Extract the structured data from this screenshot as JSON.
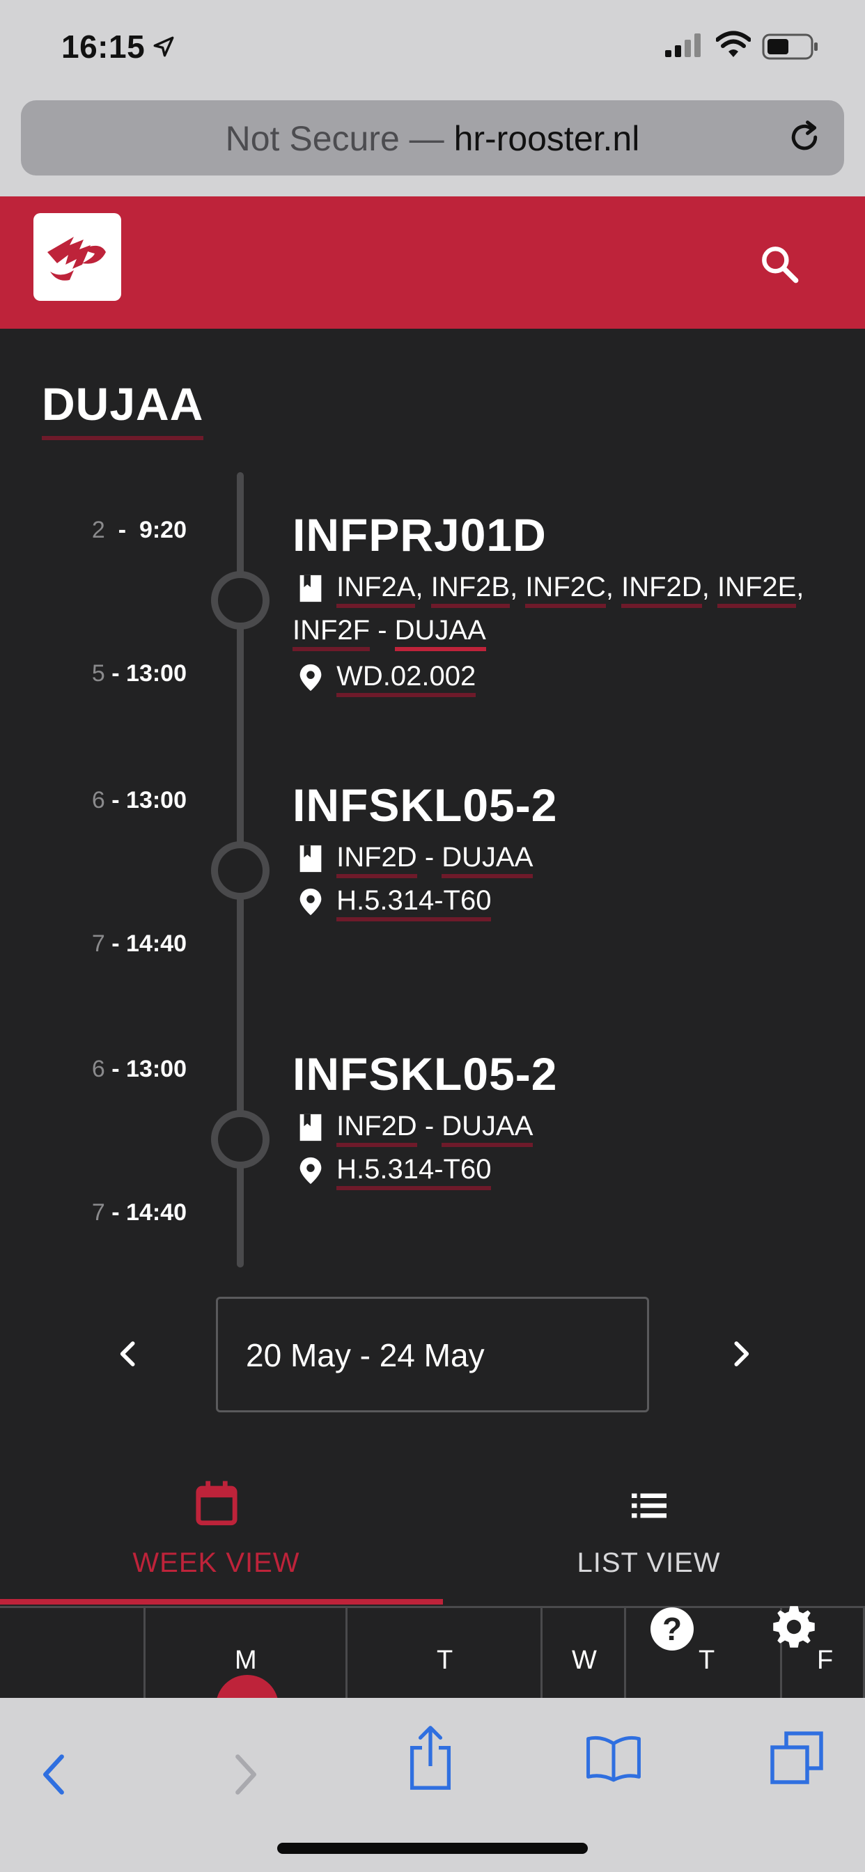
{
  "status_bar": {
    "time": "16:15"
  },
  "browser": {
    "security_label": "Not Secure —",
    "domain": "hr-rooster.nl"
  },
  "page_name": "DUJAA",
  "events": [
    {
      "start_period": "2",
      "start_time": "9:20",
      "end_period": "5",
      "end_time": "13:00",
      "code": "INFPRJ01D",
      "classes": [
        "INF2A",
        "INF2B",
        "INF2C",
        "INF2D",
        "INF2E",
        "INF2F"
      ],
      "teacher": "DUJAA",
      "room": "WD.02.002"
    },
    {
      "start_period": "6",
      "start_time": "13:00",
      "end_period": "7",
      "end_time": "14:40",
      "code": "INFSKL05-2",
      "classes": [
        "INF2D"
      ],
      "teacher": "DUJAA",
      "room": "H.5.314-T60"
    },
    {
      "start_period": "6",
      "start_time": "13:00",
      "end_period": "7",
      "end_time": "14:40",
      "code": "INFSKL05-2",
      "classes": [
        "INF2D"
      ],
      "teacher": "DUJAA",
      "room": "H.5.314-T60"
    }
  ],
  "week_nav": {
    "range": "20 May - 24 May"
  },
  "tabs": [
    {
      "label": "WEEK VIEW",
      "active": true
    },
    {
      "label": "LIST VIEW",
      "active": false
    }
  ],
  "days": [
    "M",
    "T",
    "W",
    "T",
    "F"
  ],
  "colors": {
    "brand": "#be233a",
    "underline": "#6e1a2a",
    "background": "#222223"
  }
}
